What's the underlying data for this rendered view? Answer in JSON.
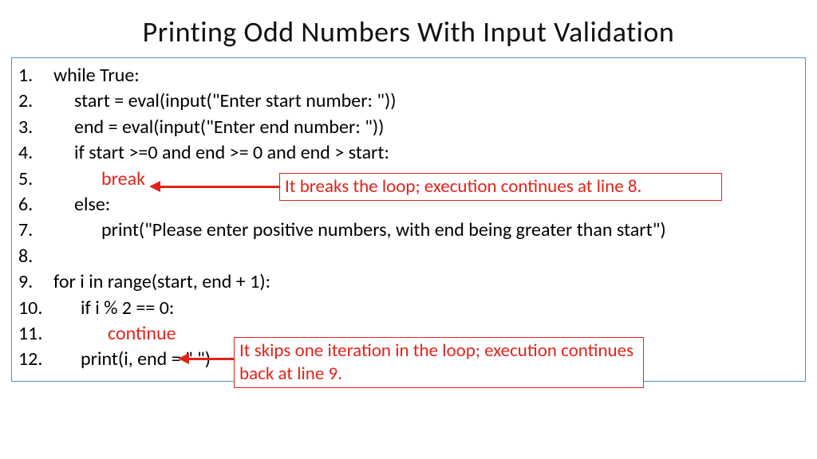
{
  "title": "Printing Odd Numbers With Input Validation",
  "code": {
    "l1": "while True:",
    "l2": "start = eval(input(\"Enter start number: \"))",
    "l3": "end = eval(input(\"Enter end number: \"))",
    "l4": "if start >=0 and end >= 0 and end > start:",
    "l5": "break",
    "l6": "else:",
    "l7": "print(\"Please enter positive numbers, with end being greater than start\")",
    "l8": "",
    "l9": "for i in range(start, end + 1):",
    "l10": "if i % 2 == 0:",
    "l11": "continue",
    "l12": "print(i, end = \" \")"
  },
  "nums": {
    "n1": "1.",
    "n2": "2.",
    "n3": "3.",
    "n4": "4.",
    "n5": "5.",
    "n6": "6.",
    "n7": "7.",
    "n8": "8.",
    "n9": "9.",
    "n10": "10.",
    "n11": "11.",
    "n12": "12."
  },
  "callouts": {
    "c1": "It breaks the loop; execution continues at line 8.",
    "c2": "It skips one iteration in the loop; execution continues back at line 9."
  }
}
